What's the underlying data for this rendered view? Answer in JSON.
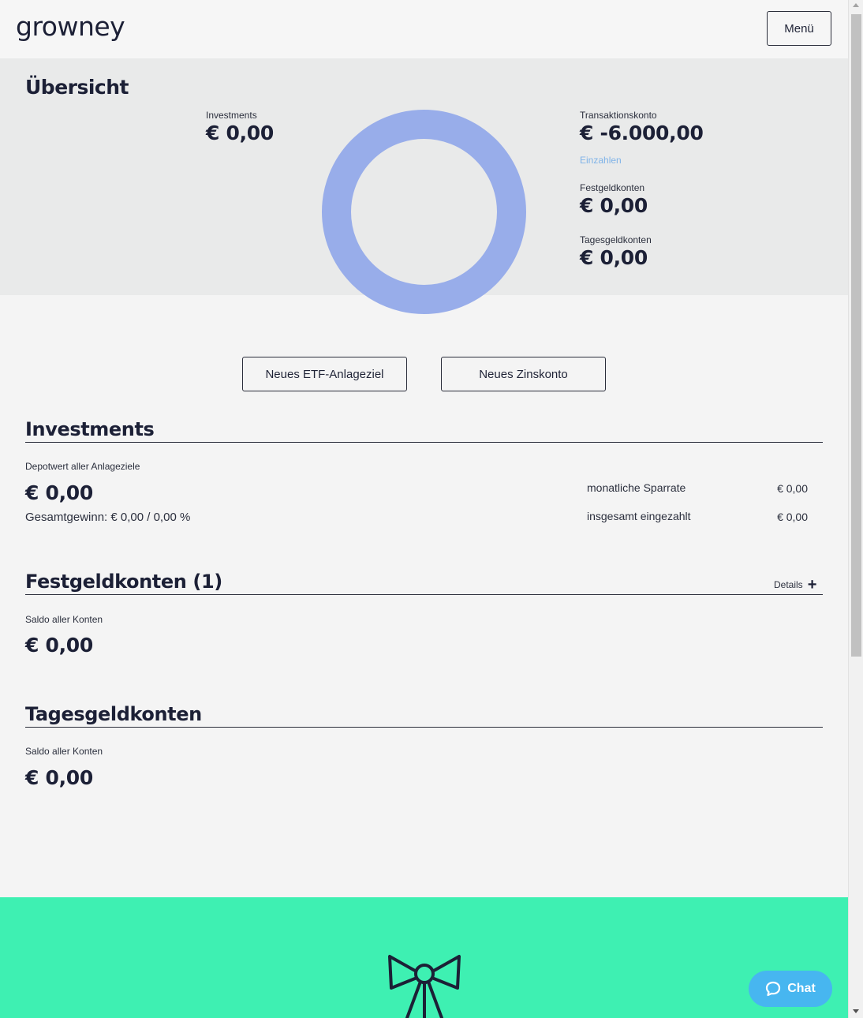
{
  "header": {
    "logo": "growney",
    "menu_label": "Menü"
  },
  "overview": {
    "title": "Übersicht",
    "investments": {
      "label": "Investments",
      "value": "€ 0,00"
    },
    "transaktionskonto": {
      "label": "Transaktionskonto",
      "value": "€ -6.000,00",
      "link": "Einzahlen"
    },
    "festgeldkonten": {
      "label": "Festgeldkonten",
      "value": "€ 0,00"
    },
    "tagesgeldkonten": {
      "label": "Tagesgeldkonten",
      "value": "€ 0,00"
    },
    "donut_color": "#98adea"
  },
  "actions": {
    "etf_label": "Neues ETF-Anlageziel",
    "zins_label": "Neues Zinskonto"
  },
  "investments": {
    "title": "Investments",
    "depot_label": "Depotwert aller Anlageziele",
    "depot_value": "€ 0,00",
    "gesamtgewinn": "Gesamtgewinn: € 0,00 / 0,00 %",
    "sparrate_label": "monatliche Sparrate",
    "sparrate_value": "€ 0,00",
    "eingezahlt_label": "insgesamt eingezahlt",
    "eingezahlt_value": "€ 0,00"
  },
  "festgeld": {
    "title": "Festgeldkonten (1)",
    "details_label": "Details",
    "saldo_label": "Saldo aller Konten",
    "saldo_value": "€ 0,00"
  },
  "tagesgeld": {
    "title": "Tagesgeldkonten",
    "saldo_label": "Saldo aller Konten",
    "saldo_value": "€ 0,00"
  },
  "footer": {
    "background": "#3ef0b2",
    "icon": "bow-tie-icon"
  },
  "chat": {
    "label": "Chat",
    "color": "#47b6f0"
  }
}
